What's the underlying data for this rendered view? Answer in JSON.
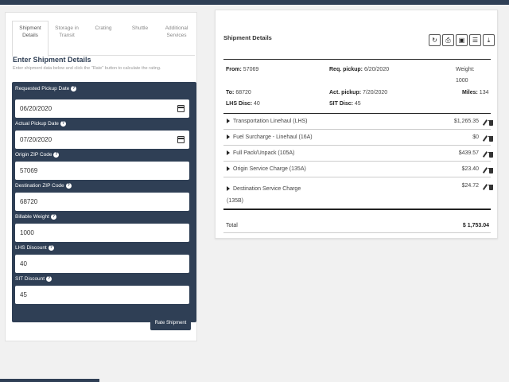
{
  "tabs": [
    {
      "label": "Shipment Details",
      "active": true
    },
    {
      "label": "Storage in Transit",
      "active": false
    },
    {
      "label": "Crating",
      "active": false
    },
    {
      "label": "Shuttle",
      "active": false
    },
    {
      "label": "Additional Services",
      "active": false
    }
  ],
  "form": {
    "title": "Enter Shipment Details",
    "subtitle": "Enter shipment data below and click the \"Rate\" button to calculate the rating.",
    "fields": [
      {
        "label": "Requested Pickup Date",
        "value": "06/20/2020",
        "type": "date"
      },
      {
        "label": "Actual Pickup Date",
        "value": "07/20/2020",
        "type": "date"
      },
      {
        "label": "Origin ZIP Code",
        "value": "57069",
        "type": "text"
      },
      {
        "label": "Destination ZIP Code",
        "value": "68720",
        "type": "text"
      },
      {
        "label": "Billable Weight",
        "value": "1000",
        "type": "text"
      },
      {
        "label": "LHS Discount",
        "value": "40",
        "type": "text"
      },
      {
        "label": "SIT Discount",
        "value": "45",
        "type": "text"
      }
    ],
    "rate_button": "Rate Shipment",
    "help_icon": "question-circle-icon"
  },
  "details": {
    "title": "Shipment Details",
    "toolbar_icons": [
      "refresh-icon",
      "print-icon",
      "save-icon",
      "list-icon",
      "download-icon"
    ],
    "from_label": "From:",
    "from_value": "57069",
    "to_label": "To:",
    "to_value": "68720",
    "lhs_label": "LHS Disc:",
    "lhs_value": "40",
    "req_label": "Req. pickup:",
    "req_value": "6/20/2020",
    "act_label": "Act. pickup:",
    "act_value": "7/20/2020",
    "sit_label": "SIT Disc:",
    "sit_value": "45",
    "weight_label": "Weight:",
    "weight_value": "1000",
    "miles_label": "Miles:",
    "miles_value": "134",
    "charges": [
      {
        "label": "Transportation Linehaul (LHS)",
        "amount": "$1,265.35"
      },
      {
        "label": "Fuel Surcharge - Linehaul (16A)",
        "amount": "$0"
      },
      {
        "label": "Full Pack/Unpack (105A)",
        "amount": "$439.57"
      },
      {
        "label": "Origin Service Charge (135A)",
        "amount": "$23.40"
      },
      {
        "label": "Destination Service Charge (135B)",
        "amount": "$24.72"
      }
    ],
    "total_label": "Total",
    "total_value": "$ 1,753.04"
  }
}
